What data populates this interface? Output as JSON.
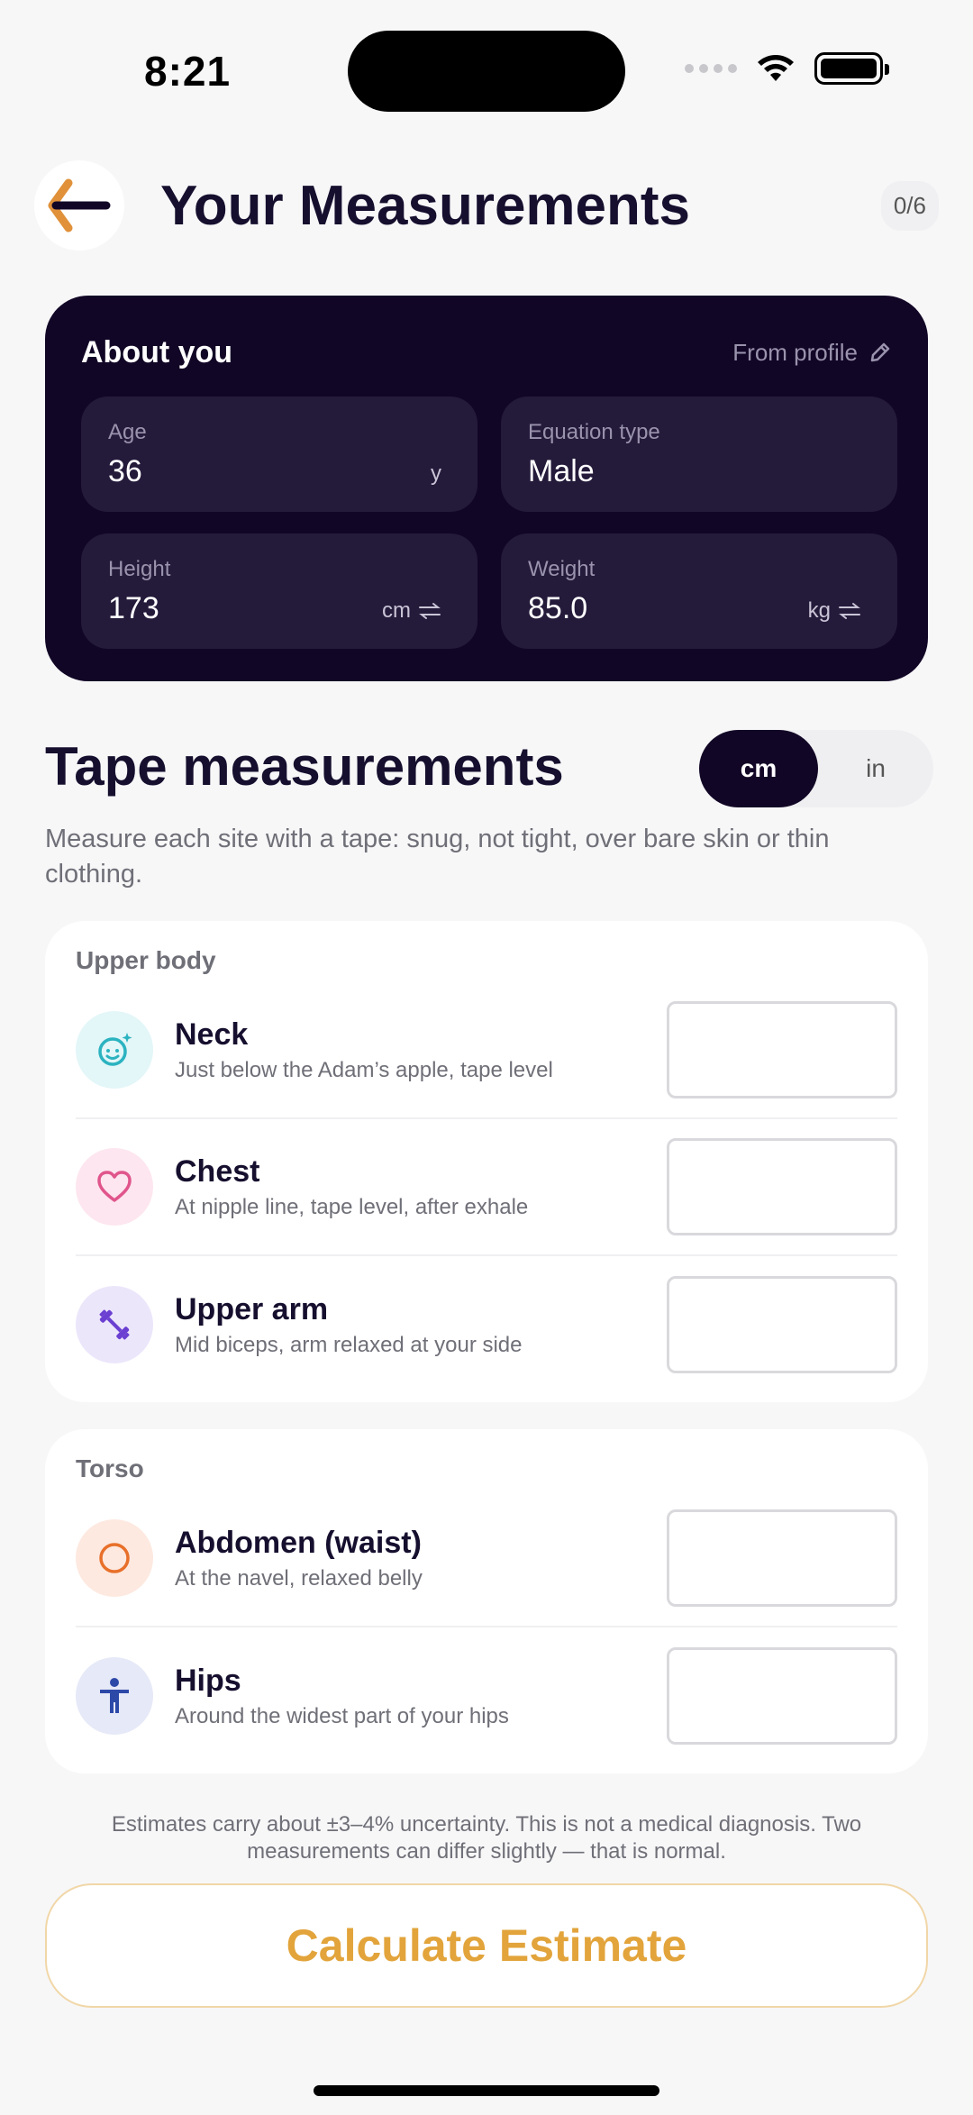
{
  "status": {
    "time": "8:21"
  },
  "header": {
    "title": "Your Measurements",
    "progress": "0/6"
  },
  "about": {
    "title": "About you",
    "from_profile": "From profile",
    "fields": {
      "age": {
        "label": "Age",
        "value": "36",
        "unit": "y"
      },
      "equation": {
        "label": "Equation type",
        "value": "Male"
      },
      "height": {
        "label": "Height",
        "value": "173",
        "unit": "cm"
      },
      "weight": {
        "label": "Weight",
        "value": "85.0",
        "unit": "kg"
      }
    }
  },
  "tape": {
    "title": "Tape measurements",
    "units": [
      "cm",
      "in"
    ],
    "selected_unit": "cm",
    "description": "Measure each site with a tape: snug, not tight, over bare skin or thin clothing."
  },
  "sections": {
    "upper": {
      "title": "Upper body",
      "rows": [
        {
          "name": "Neck",
          "hint": "Just below the Adam’s apple, tape level",
          "value": ""
        },
        {
          "name": "Chest",
          "hint": "At nipple line, tape level, after exhale",
          "value": ""
        },
        {
          "name": "Upper arm",
          "hint": "Mid biceps, arm relaxed at your side",
          "value": ""
        }
      ]
    },
    "torso": {
      "title": "Torso",
      "rows": [
        {
          "name": "Abdomen (waist)",
          "hint": "At the navel, relaxed belly",
          "value": ""
        },
        {
          "name": "Hips",
          "hint": "Around the widest part of your hips",
          "value": ""
        }
      ]
    }
  },
  "disclaimer": "Estimates carry about ±3–4% uncertainty. This is not a medical diagnosis. Two measurements can differ slightly — that is normal.",
  "calculate_label": "Calculate Estimate",
  "colors": {
    "accent": "#e2a43b",
    "dark_card": "#120626",
    "back_arrow": "#e0913a"
  },
  "icons": {
    "neck": "face-icon",
    "chest": "heart-icon",
    "upper_arm": "dumbbell-icon",
    "abdomen": "circle-icon",
    "hips": "person-icon"
  }
}
